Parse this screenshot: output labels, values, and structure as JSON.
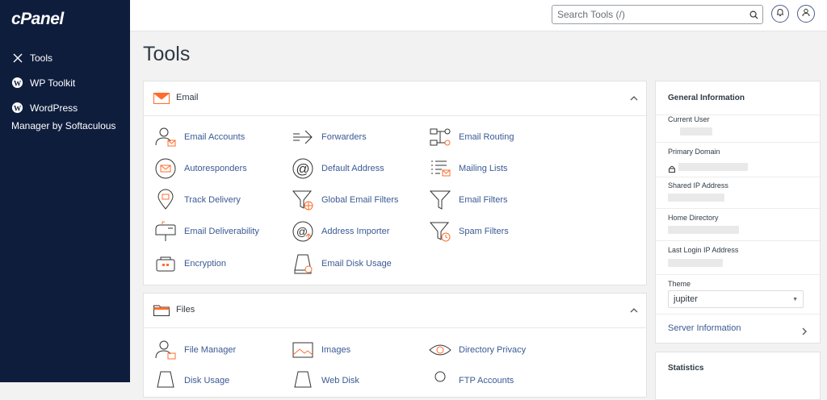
{
  "brand": {
    "logo": "cPanel"
  },
  "sidebar": {
    "items": [
      {
        "label": "Tools",
        "icon": "tools-icon"
      },
      {
        "label": "WP Toolkit",
        "icon": "wordpress-icon"
      },
      {
        "label": "WordPress Manager by Softaculous",
        "icon": "wordpress-icon"
      }
    ]
  },
  "header": {
    "search_placeholder": "Search Tools (/)"
  },
  "page": {
    "title": "Tools"
  },
  "email_section": {
    "title": "Email",
    "tools": [
      [
        "Email Accounts",
        "Forwarders",
        "Email Routing"
      ],
      [
        "Autoresponders",
        "Default Address",
        "Mailing Lists"
      ],
      [
        "Track Delivery",
        "Global Email Filters",
        "Email Filters"
      ],
      [
        "Email Deliverability",
        "Address Importer",
        "Spam Filters"
      ],
      [
        "Encryption",
        "Email Disk Usage"
      ]
    ]
  },
  "files_section": {
    "title": "Files",
    "tools": [
      [
        "File Manager",
        "Images",
        "Directory Privacy"
      ],
      [
        "Disk Usage",
        "Web Disk",
        "FTP Accounts"
      ]
    ]
  },
  "general_info": {
    "title": "General Information",
    "current_user_label": "Current User",
    "primary_domain_label": "Primary Domain",
    "shared_ip_label": "Shared IP Address",
    "home_dir_label": "Home Directory",
    "last_login_label": "Last Login IP Address",
    "theme_label": "Theme",
    "theme_value": "jupiter",
    "server_info_label": "Server Information"
  },
  "statistics": {
    "title": "Statistics"
  },
  "colors": {
    "sidebar": "#0f1d3d",
    "accent": "#ff6c2c",
    "link": "#3a5a94"
  }
}
